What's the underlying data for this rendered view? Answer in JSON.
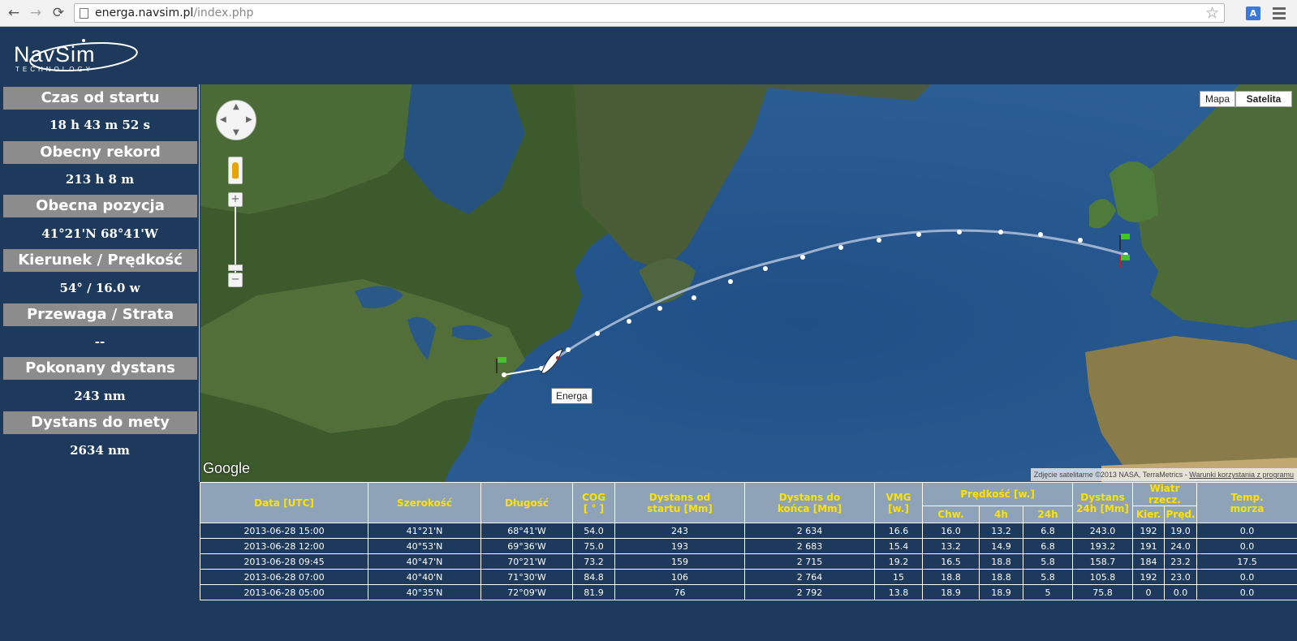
{
  "browser": {
    "back_icon": "back-arrow-icon",
    "forward_icon": "forward-arrow-icon",
    "reload_icon": "reload-icon",
    "url_host": "energa.navsim.pl",
    "url_path": "/index.php"
  },
  "header": {
    "logo_text": "NavSim",
    "logo_subtext": "TECHNOLOGY"
  },
  "sidebar": {
    "items": [
      {
        "label": "Czas od startu",
        "value": "18 h 43 m 52 s"
      },
      {
        "label": "Obecny rekord",
        "value": "213 h 8 m"
      },
      {
        "label": "Obecna pozycja",
        "value": "41°21'N 68°41'W"
      },
      {
        "label": "Kierunek / Prędkość",
        "value": "54° / 16.0 w"
      },
      {
        "label": "Przewaga / Strata",
        "value": "--"
      },
      {
        "label": "Pokonany dystans",
        "value": "243 nm"
      },
      {
        "label": "Dystans do mety",
        "value": "2634 nm"
      }
    ]
  },
  "map": {
    "type_map": "Mapa",
    "type_satellite": "Satelita",
    "boat_label": "Energa",
    "google_logo": "Google",
    "attribution": "Zdjęcie satelitarne ©2013 NASA, TerraMetrics - ",
    "terms_link": "Warunki korzystania z programu",
    "zoom_in": "+",
    "zoom_out": "−"
  },
  "table": {
    "headers": {
      "date": "Data [UTC]",
      "lat": "Szerokość",
      "lon": "Długość",
      "cog_1": "COG",
      "cog_2": "[ ° ]",
      "dist_start_1": "Dystans od",
      "dist_start_2": "startu [Mm]",
      "dist_end_1": "Dystans do",
      "dist_end_2": "końca [Mm]",
      "vmg_1": "VMG",
      "vmg_2": "[w.]",
      "speed": "Prędkość [w.]",
      "speed_cur": "Chw.",
      "speed_4h": "4h",
      "speed_24h": "24h",
      "dist24_1": "Dystans",
      "dist24_2": "24h [Mm]",
      "wind": "Wiatr rzecz.",
      "wind_dir": "Kier.",
      "wind_speed": "Pręd.",
      "temp_1": "Temp.",
      "temp_2": "morza"
    },
    "rows": [
      {
        "date": "2013-06-28 15:00",
        "lat": "41°21'N",
        "lon": "68°41'W",
        "cog": "54.0",
        "dist_start": "243",
        "dist_end": "2 634",
        "vmg": "16.6",
        "s_cur": "16.0",
        "s_4h": "13.2",
        "s_24h": "6.8",
        "d24": "243.0",
        "w_dir": "192",
        "w_spd": "19.0",
        "temp": "0.0"
      },
      {
        "date": "2013-06-28 12:00",
        "lat": "40°53'N",
        "lon": "69°36'W",
        "cog": "75.0",
        "dist_start": "193",
        "dist_end": "2 683",
        "vmg": "15.4",
        "s_cur": "13.2",
        "s_4h": "14.9",
        "s_24h": "6.8",
        "d24": "193.2",
        "w_dir": "191",
        "w_spd": "24.0",
        "temp": "0.0"
      },
      {
        "date": "2013-06-28 09:45",
        "lat": "40°47'N",
        "lon": "70°21'W",
        "cog": "73.2",
        "dist_start": "159",
        "dist_end": "2 715",
        "vmg": "19.2",
        "s_cur": "16.5",
        "s_4h": "18.8",
        "s_24h": "5.8",
        "d24": "158.7",
        "w_dir": "184",
        "w_spd": "23.2",
        "temp": "17.5"
      },
      {
        "date": "2013-06-28 07:00",
        "lat": "40°40'N",
        "lon": "71°30'W",
        "cog": "84.8",
        "dist_start": "106",
        "dist_end": "2 764",
        "vmg": "15",
        "s_cur": "18.8",
        "s_4h": "18.8",
        "s_24h": "5.8",
        "d24": "105.8",
        "w_dir": "192",
        "w_spd": "23.0",
        "temp": "0.0"
      },
      {
        "date": "2013-06-28 05:00",
        "lat": "40°35'N",
        "lon": "72°09'W",
        "cog": "81.9",
        "dist_start": "76",
        "dist_end": "2 792",
        "vmg": "13.8",
        "s_cur": "18.9",
        "s_4h": "18.9",
        "s_24h": "5",
        "d24": "75.8",
        "w_dir": "0",
        "w_spd": "0.0",
        "temp": "0.0"
      }
    ]
  }
}
